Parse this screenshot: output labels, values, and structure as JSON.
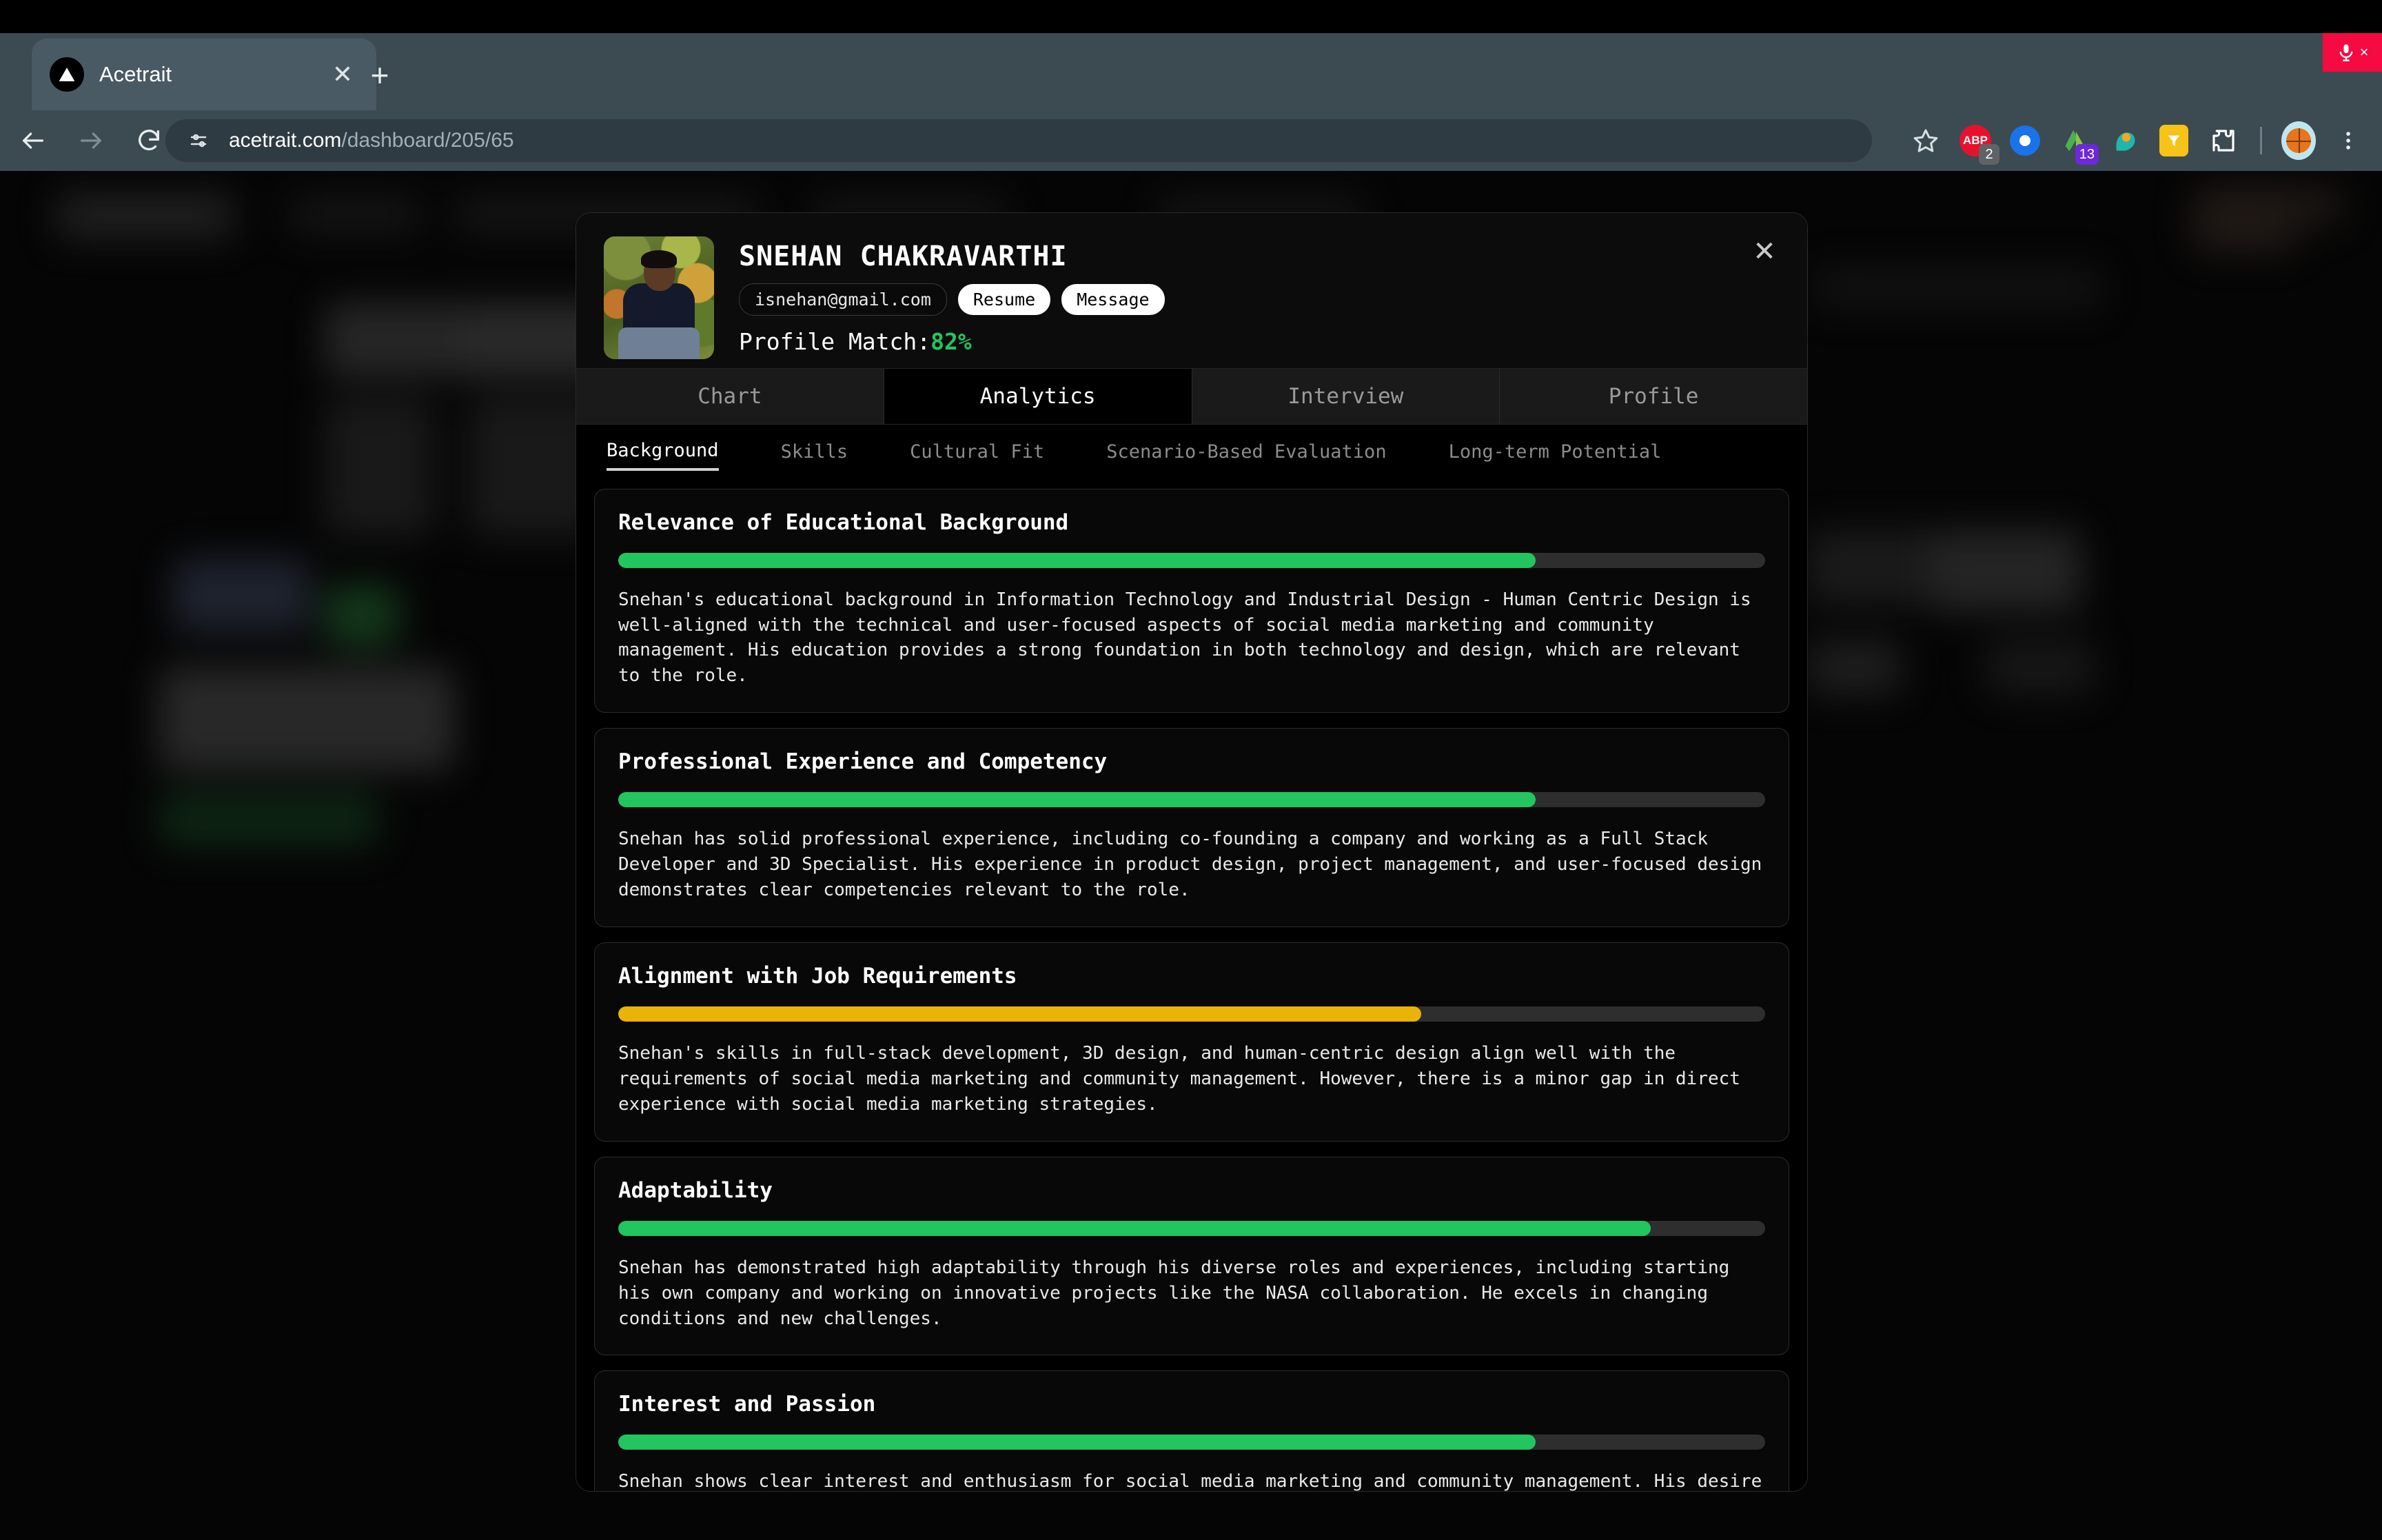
{
  "browser": {
    "tab": {
      "title": "Acetrait",
      "favicon_icon": "triangle-logo-icon",
      "close_icon": "close-icon"
    },
    "new_tab_icon": "plus-icon",
    "back_icon": "back-arrow-icon",
    "forward_icon": "forward-arrow-icon",
    "reload_icon": "reload-icon",
    "omnibox": {
      "site_settings_icon": "tune-icon",
      "url_host": "acetrait.com",
      "url_path": "/dashboard/205/65",
      "bookmark_icon": "star-icon"
    },
    "extensions": [
      {
        "name": "adblock-plus-icon",
        "badge": "2",
        "badge_color": "#5f6368",
        "color": "#e8112d",
        "glyph": "ABP"
      },
      {
        "name": "blue-circle-extension-icon",
        "badge": "",
        "badge_color": "",
        "color": "#1a73e8",
        "glyph": ""
      },
      {
        "name": "green-shapes-extension-icon",
        "badge": "13",
        "badge_color": "#6d28d9",
        "color": "#4caf50",
        "glyph": ""
      },
      {
        "name": "teal-head-extension-icon",
        "badge": "",
        "badge_color": "",
        "color": "#1fb6ad",
        "glyph": ""
      },
      {
        "name": "yellow-funnel-extension-icon",
        "badge": "",
        "badge_color": "",
        "color": "#f6c316",
        "glyph": ""
      },
      {
        "name": "puzzle-extensions-icon",
        "badge": "",
        "badge_color": "",
        "color": "#ffffff",
        "glyph": ""
      }
    ],
    "profile_avatar_icon": "basketball-avatar-icon",
    "menu_icon": "three-dot-menu-icon",
    "recording_banner": {
      "mic_icon": "microphone-icon",
      "close_label": "×",
      "color": "#f50a42"
    }
  },
  "modal": {
    "close_icon": "close-icon",
    "candidate": {
      "name": "SNEHAN CHAKRAVARTHI",
      "email": "isnehan@gmail.com",
      "resume_label": "Resume",
      "message_label": "Message",
      "match_label": "Profile Match:",
      "match_value": "82%",
      "match_color": "#22c55e",
      "avatar_icon": "candidate-photo"
    },
    "tabs": [
      {
        "label": "Chart",
        "active": false
      },
      {
        "label": "Analytics",
        "active": true
      },
      {
        "label": "Interview",
        "active": false
      },
      {
        "label": "Profile",
        "active": false
      }
    ],
    "subtabs": [
      {
        "label": "Background",
        "active": true
      },
      {
        "label": "Skills",
        "active": false
      },
      {
        "label": "Cultural Fit",
        "active": false
      },
      {
        "label": "Scenario-Based Evaluation",
        "active": false
      },
      {
        "label": "Long-term Potential",
        "active": false
      }
    ],
    "cards": [
      {
        "title": "Relevance of Educational Background",
        "score_pct": 80,
        "bar_color": "#22c55e",
        "text": "Snehan's educational background in Information Technology and Industrial Design - Human Centric Design is well-aligned with the technical and user-focused aspects of social media marketing and community management. His education provides a strong foundation in both technology and design, which are relevant to the role."
      },
      {
        "title": "Professional Experience and Competency",
        "score_pct": 80,
        "bar_color": "#22c55e",
        "text": "Snehan has solid professional experience, including co-founding a company and working as a Full Stack Developer and 3D Specialist. His experience in product design, project management, and user-focused design demonstrates clear competencies relevant to the role."
      },
      {
        "title": "Alignment with Job Requirements",
        "score_pct": 70,
        "bar_color": "#eab308",
        "text": "Snehan's skills in full-stack development, 3D design, and human-centric design align well with the requirements of social media marketing and community management. However, there is a minor gap in direct experience with social media marketing strategies."
      },
      {
        "title": "Adaptability",
        "score_pct": 90,
        "bar_color": "#22c55e",
        "text": "Snehan has demonstrated high adaptability through his diverse roles and experiences, including starting his own company and working on innovative projects like the NASA collaboration. He excels in changing conditions and new challenges."
      },
      {
        "title": "Interest and Passion",
        "score_pct": 80,
        "bar_color": "#22c55e",
        "text": "Snehan shows clear interest and enthusiasm for social media marketing and community management. His desire to blend creativity with technology and his proactive approach to staying updated with"
      }
    ]
  }
}
